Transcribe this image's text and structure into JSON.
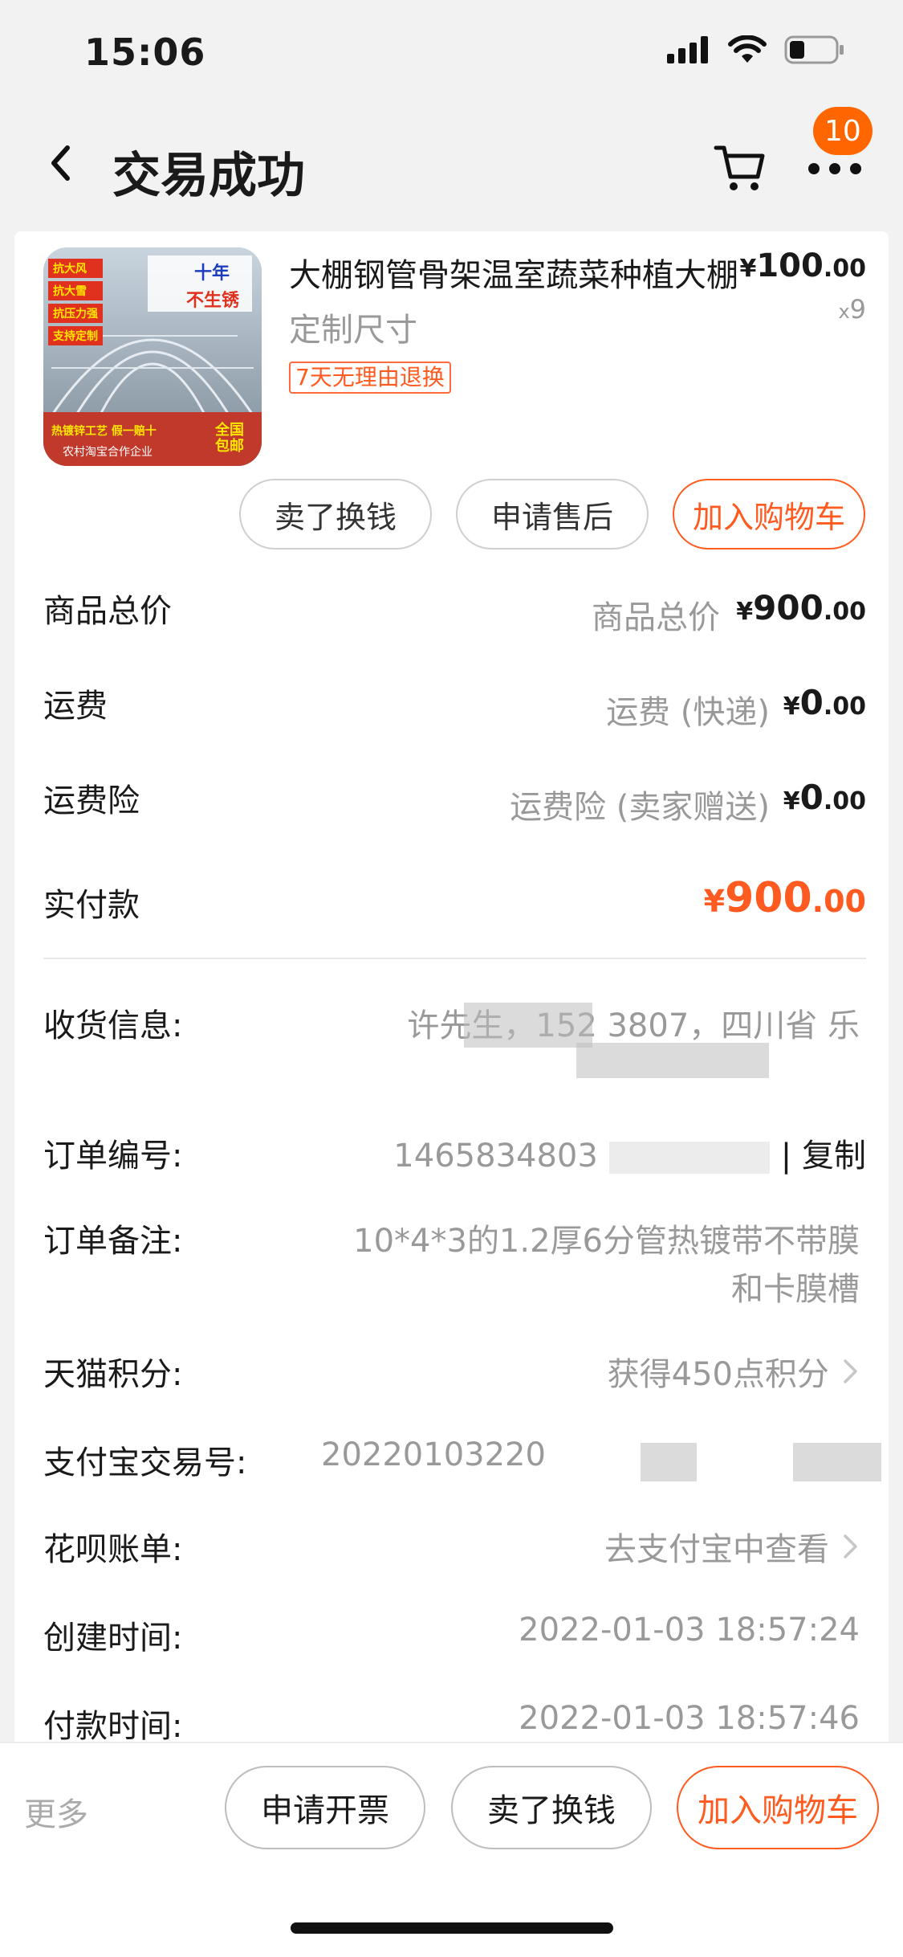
{
  "status_bar": {
    "time": "15:06"
  },
  "nav": {
    "title": "交易成功",
    "badge_count": "10"
  },
  "product": {
    "title": "大棚钢管骨架温室蔬菜种植大棚",
    "spec": "定制尺寸",
    "tag": "7天无理由退换",
    "price_yen": "¥",
    "price_int": "100",
    "price_dec": ".00",
    "qty_x": "x",
    "qty_num": "9",
    "thumb_text": {
      "top_left": [
        "抗大风",
        "抗大雪",
        "抗压力强",
        "支持定制"
      ],
      "badge_a": "十年",
      "badge_b": "不生锈",
      "bottom_a": "热镀锌工艺 假一赔十",
      "bottom_b": "农村淘宝合作企业",
      "corner": "全国包邮"
    }
  },
  "actions": {
    "sell": "卖了换钱",
    "after_sale": "申请售后",
    "add_cart": "加入购物车"
  },
  "costs": {
    "goods_total_label": "商品总价",
    "goods_total_sub": "商品总价",
    "goods_total_int": "900",
    "freight_label": "运费",
    "freight_sub": "运费 (快递)",
    "freight_int": "0",
    "freight_ins_label": "运费险",
    "freight_ins_sub": "运费险 (卖家赠送)",
    "freight_ins_int": "0",
    "paid_label": "实付款",
    "paid_int": "900",
    "yen": "¥",
    "dec": ".00"
  },
  "info": {
    "receiver_label": "收货信息:",
    "receiver_value": "许先生，152 3807，四川省 乐",
    "order_no_label": "订单编号:",
    "order_no_value": "1465834803",
    "copy": "| 复制",
    "note_label": "订单备注:",
    "note_line1": "10*4*3的1.2厚6分管热镀带不带膜",
    "note_line2": "和卡膜槽",
    "points_label": "天猫积分:",
    "points_value": "获得450点积分",
    "alipay_label": "支付宝交易号:",
    "alipay_value": "20220103220",
    "huabei_label": "花呗账单:",
    "huabei_value": "去支付宝中查看",
    "created_label": "创建时间:",
    "created_value": "2022-01-03 18:57:24",
    "paid_time_label": "付款时间:",
    "paid_time_value": "2022-01-03 18:57:46"
  },
  "bottom": {
    "more": "更多",
    "invoice": "申请开票",
    "sell": "卖了换钱",
    "add_cart": "加入购物车"
  },
  "colors": {
    "accent": "#ff5a1f",
    "badge": "#ff6600",
    "muted": "#999999"
  }
}
